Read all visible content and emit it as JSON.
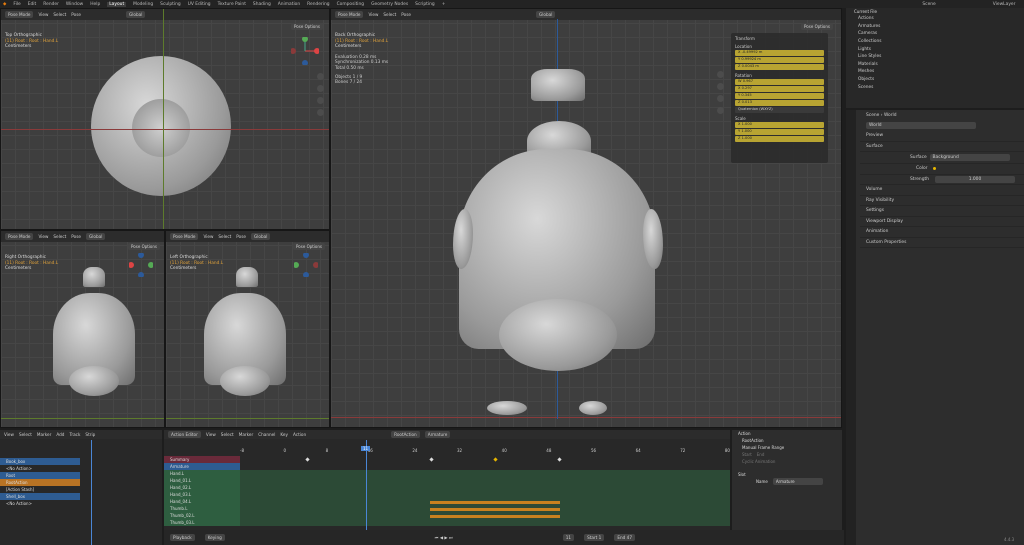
{
  "topbar": {
    "menus": [
      "File",
      "Edit",
      "Render",
      "Window",
      "Help"
    ],
    "workspaces": [
      "Layout",
      "Modeling",
      "Sculpting",
      "UV Editing",
      "Texture Paint",
      "Shading",
      "Animation",
      "Rendering",
      "Compositing",
      "Geometry Nodes",
      "Scripting"
    ],
    "scene": "Scene",
    "view_layer": "ViewLayer"
  },
  "vp_top": {
    "mode": "Pose Mode",
    "menus": [
      "View",
      "Select",
      "Pose"
    ],
    "orientation": "Global",
    "pose_options": "Pose Options",
    "title": "Top Orthographic",
    "sub": "(11) Root : Root : Hand.L",
    "units": "Centimeters"
  },
  "vp_back": {
    "mode": "Pose Mode",
    "menus": [
      "View",
      "Select",
      "Pose"
    ],
    "orientation": "Global",
    "pose_options": "Pose Options",
    "title": "Back Orthographic",
    "sub": "(11) Root : Root : Hand.L",
    "units": "Centimeters",
    "stats": [
      {
        "k": "Evaluation",
        "v": "0.28 ms"
      },
      {
        "k": "Synchronization",
        "v": "0.13 ms"
      },
      {
        "k": "Total",
        "v": "0.50 ms"
      },
      {
        "k": "Objects",
        "v": "1 / 9"
      },
      {
        "k": "Bones",
        "v": "7 / 24"
      }
    ]
  },
  "vp_right": {
    "mode": "Pose Mode",
    "menus": [
      "View",
      "Select",
      "Pose"
    ],
    "orientation": "Global",
    "pose_options": "Pose Options",
    "title": "Right Orthographic",
    "sub": "(11) Root : Root : Hand.L",
    "units": "Centimeters"
  },
  "vp_left": {
    "mode": "Pose Mode",
    "menus": [
      "View",
      "Select",
      "Pose"
    ],
    "orientation": "Global",
    "pose_options": "Pose Options",
    "title": "Left Orthographic",
    "sub": "(11) Root : Root : Hand.L",
    "units": "Centimeters"
  },
  "npanel": {
    "transform": "Transform",
    "location": "Location",
    "loc": [
      "-0.49992 m",
      "0.99924 m",
      "0.0043 m"
    ],
    "rotation": "Rotation",
    "rot": [
      "0.967",
      "0.297",
      "0.345",
      "0.013"
    ],
    "mode": "Quaternion (WXYZ)",
    "scale": "Scale",
    "scl": [
      "1.000",
      "1.000",
      "1.000"
    ],
    "axes": [
      "X",
      "Y",
      "Z",
      "W"
    ]
  },
  "outliner": {
    "title": "Current File",
    "items": [
      "Actions",
      "Armatures",
      "Cameras",
      "Collections",
      "Lights",
      "Line Styles",
      "Materials",
      "Meshes",
      "Objects",
      "Scenes"
    ]
  },
  "props": {
    "scene": "Scene",
    "world_path": "World",
    "world": "World",
    "rows": [
      "Preview",
      "Surface",
      "Volume",
      "Ray Visibility",
      "Settings",
      "Viewport Display",
      "Animation",
      "Custom Properties"
    ],
    "surface_label": "Surface",
    "surface_value": "Background",
    "color_label": "Color",
    "strength_label": "Strength",
    "strength_value": "1.000"
  },
  "nla": {
    "menus": [
      "View",
      "Select",
      "Marker",
      "Add",
      "Track",
      "Strip"
    ],
    "tracks": [
      "Book_box",
      "<No Action>",
      "Root",
      "RootAction",
      "[Action Stash]",
      "Shell_box",
      "<No Action>"
    ]
  },
  "action": {
    "editor": "Action Editor",
    "menus": [
      "View",
      "Select",
      "Marker",
      "Channel",
      "Key",
      "Action"
    ],
    "action_name": "RootAction",
    "armature": "Armature",
    "channels": [
      "Summary",
      "Armature",
      "Hand.L",
      "Hand_01.L",
      "Hand_02.L",
      "Hand_03.L",
      "Hand_04.L",
      "Thumb.L",
      "Thumb_02.L",
      "Thumb_03.L"
    ],
    "frame_ticks": [
      "-8",
      "0",
      "8",
      "16",
      "24",
      "32",
      "40",
      "48",
      "56",
      "64",
      "72",
      "80"
    ],
    "current_frame": "11"
  },
  "side": {
    "action": "Action",
    "action_name": "RootAction",
    "manual_range": "Manual Frame Range",
    "start": "Start",
    "end": "End",
    "cyclic": "Cyclic Animation",
    "slot": "Slot",
    "name_label": "Name",
    "name_value": "Armature"
  },
  "footer": {
    "playback": "Playback",
    "keying": "Keying",
    "frame": "11",
    "start_label": "Start",
    "start": "1",
    "end_label": "End",
    "end": "47",
    "version": "4.4.3"
  }
}
